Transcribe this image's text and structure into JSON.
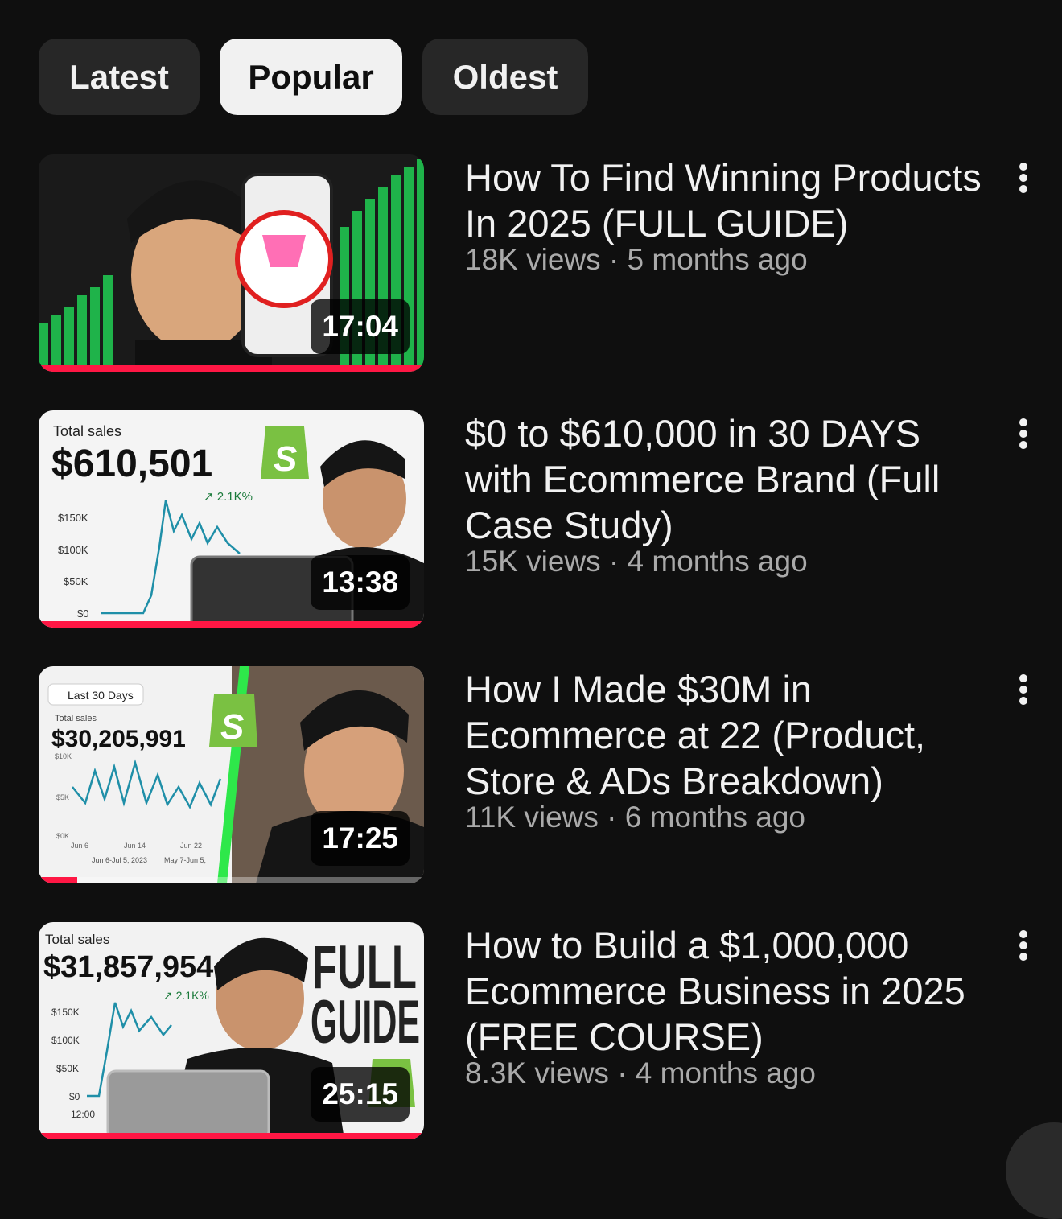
{
  "tabs": [
    {
      "label": "Latest",
      "active": false
    },
    {
      "label": "Popular",
      "active": true
    },
    {
      "label": "Oldest",
      "active": false
    }
  ],
  "videos": [
    {
      "title": "How To Find Winning Products In 2025 (FULL GUIDE)",
      "views": "18K views",
      "age": "5 months ago",
      "meta": "18K views · 5 months ago",
      "duration": "17:04",
      "progress": 1.0,
      "thumbnail": {
        "style": "green-bars-phone",
        "icon": "phone-product-icon"
      }
    },
    {
      "title": "$0 to $610,000 in 30 DAYS with Ecommerce Brand (Full Case Study)",
      "views": "15K views",
      "age": "4 months ago",
      "meta": "15K views · 4 months ago",
      "duration": "13:38",
      "progress": 1.0,
      "thumbnail": {
        "style": "sales-chart",
        "label": "Total sales",
        "amount": "$610,501",
        "growth": "↗ 2.1K%",
        "ticks": [
          "$150K",
          "$100K",
          "$50K",
          "$0"
        ]
      }
    },
    {
      "title": "How I Made $30M in Ecommerce at 22 (Product, Store & ADs Breakdown)",
      "views": "11K views",
      "age": "6 months ago",
      "meta": "11K views · 6 months ago",
      "duration": "17:25",
      "progress": 0.1,
      "thumbnail": {
        "style": "sales-chart-wave",
        "range": "Last 30 Days",
        "label": "Total sales",
        "amount": "$30,205,991",
        "ticks": [
          "$10K",
          "$5K",
          "$0K"
        ],
        "dates": [
          "Jun 6",
          "Jun 14",
          "Jun 22"
        ],
        "legend": [
          "Jun 6-Jul 5, 2023",
          "May 7-Jun 5,"
        ]
      }
    },
    {
      "title": "How to Build a $1,000,000 Ecommerce Business in 2025 (FREE COURSE)",
      "views": "8.3K views",
      "age": "4 months ago",
      "meta": "8.3K views · 4 months ago",
      "duration": "25:15",
      "progress": 1.0,
      "thumbnail": {
        "style": "sales-chart-fullguide",
        "label": "Total sales",
        "amount": "$31,857,954",
        "growth": "↗ 2.1K%",
        "ticks": [
          "$150K",
          "$100K",
          "$50K",
          "$0"
        ],
        "xtick": "12:00",
        "banner": [
          "FULL",
          "GUIDE"
        ]
      }
    }
  ],
  "colors": {
    "background": "#0f0f0f",
    "chip": "#272727",
    "chip_active": "#f1f1f1",
    "progress": "#ff1744",
    "chart_line": "#1f8fa8",
    "shopify": "#7ac142"
  }
}
